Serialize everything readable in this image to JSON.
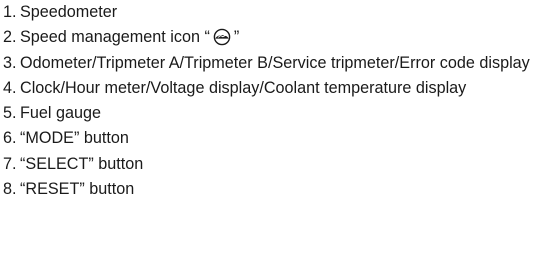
{
  "legend": {
    "items": [
      {
        "number": "1.",
        "text": "Speedometer"
      },
      {
        "number": "2.",
        "text_before_icon": "Speed management icon “",
        "icon": "speed-management-icon",
        "text_after_icon": "”"
      },
      {
        "number": "3.",
        "text": "Odometer/Tripmeter A/Tripmeter B/Service tripmeter/Error code display"
      },
      {
        "number": "4.",
        "text": "Clock/Hour meter/Voltage display/Coolant temperature display"
      },
      {
        "number": "5.",
        "text": "Fuel gauge"
      },
      {
        "number": "6.",
        "text": "“MODE” button"
      },
      {
        "number": "7.",
        "text": "“SELECT” button"
      },
      {
        "number": "8.",
        "text": "“RESET” button"
      }
    ]
  }
}
